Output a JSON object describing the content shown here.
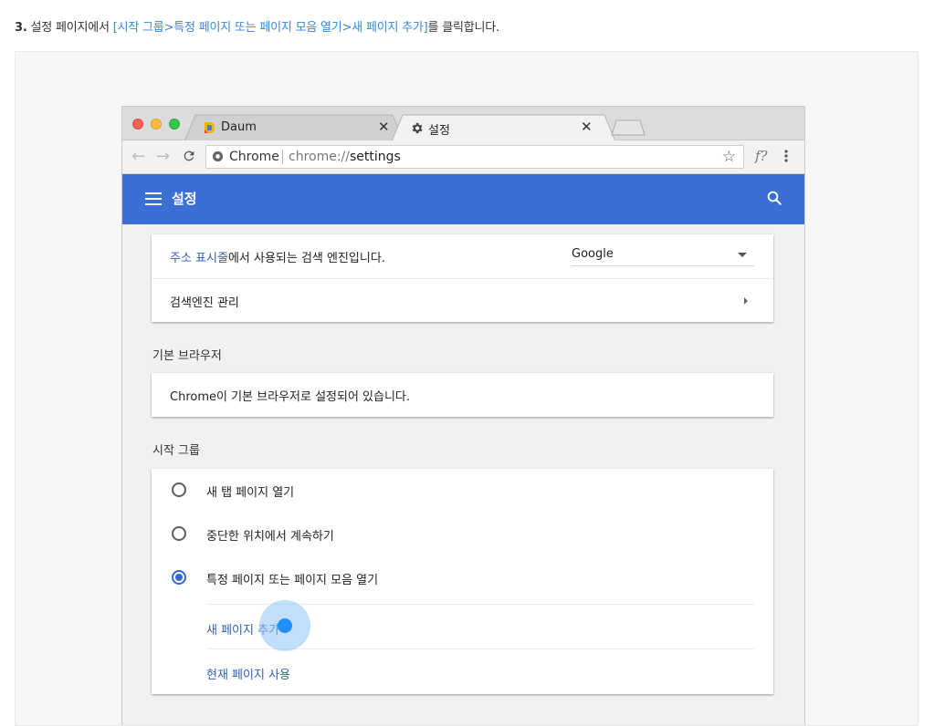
{
  "instruction": {
    "number": "3.",
    "prefix": " 설정 페이지에서 ",
    "path": "[시작 그룹>특정 페이지 또는 페이지 모음 열기>새 페이지 추가]",
    "suffix": "를 클릭합니다."
  },
  "browser": {
    "tabs": [
      {
        "label": "Daum",
        "favicon": "daum-logo-icon",
        "active": false
      },
      {
        "label": "설정",
        "favicon": "gear-icon",
        "active": true
      }
    ],
    "omnibox": {
      "site_label": "Chrome",
      "url_scheme": "chrome://",
      "url_path": "settings"
    },
    "extension_label": "f?"
  },
  "settings": {
    "app_title": "설정",
    "search_engine": {
      "description_link": "주소 표시줄",
      "description_rest": "에서 사용되는 검색 엔진입니다.",
      "selected_engine": "Google",
      "manage_label": "검색엔진 관리"
    },
    "default_browser": {
      "section_title": "기본 브라우저",
      "status_text": "Chrome이 기본 브라우저로 설정되어 있습니다."
    },
    "startup": {
      "section_title": "시작 그룹",
      "options": [
        {
          "label": "새 탭 페이지 열기",
          "checked": false
        },
        {
          "label": "중단한 위치에서 계속하기",
          "checked": false
        },
        {
          "label": "특정 페이지 또는 페이지 모음 열기",
          "checked": true
        }
      ],
      "add_page_label": "새 페이지 추가",
      "use_current_label": "현재 페이지 사용"
    }
  },
  "colors": {
    "accent": "#3b6fd3",
    "link": "#2f5fbd",
    "highlight": "#1e8fff"
  }
}
